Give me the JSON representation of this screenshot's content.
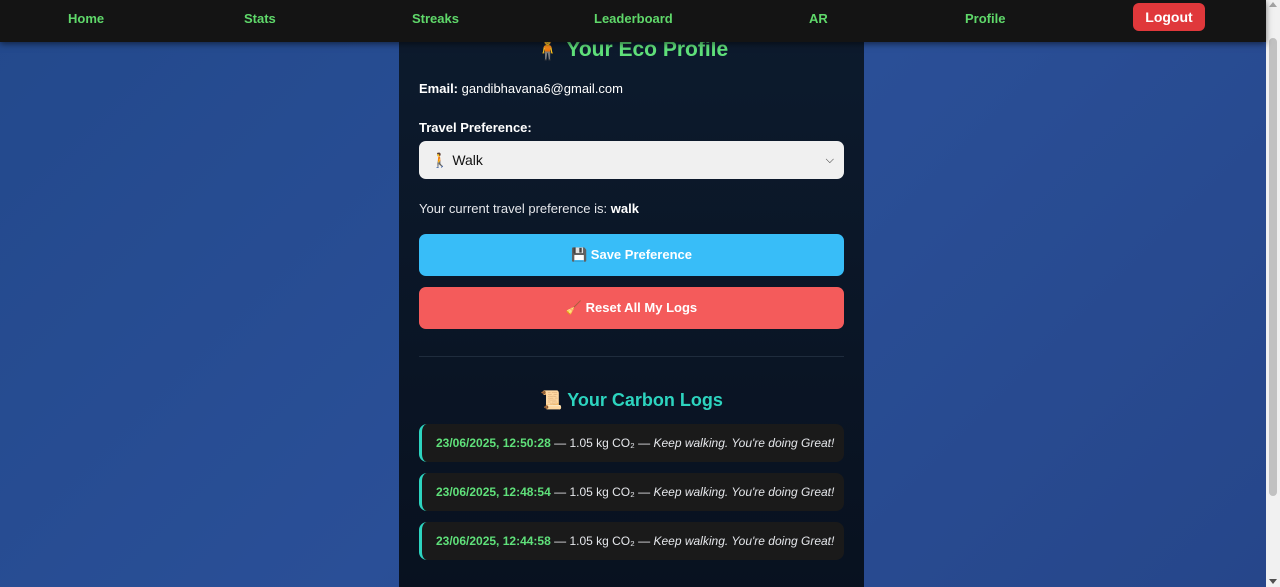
{
  "nav": {
    "home": "Home",
    "stats": "Stats",
    "streaks": "Streaks",
    "leaderboard": "Leaderboard",
    "ar": "AR",
    "profile": "Profile",
    "logout": "Logout"
  },
  "profile": {
    "title": "🧍 Your Eco Profile",
    "email_label": "Email:",
    "email_value": "gandibhavana6@gmail.com",
    "travel_label": "Travel Preference:",
    "selected_option": "🚶 Walk",
    "current_pref_text": "Your current travel preference is:",
    "current_pref_value": "walk",
    "save_button": "💾 Save Preference",
    "reset_button": "🧹 Reset All My Logs"
  },
  "logs": {
    "title": "📜 Your Carbon Logs",
    "entries": [
      {
        "date": "23/06/2025, 12:50:28",
        "amount": "— 1.05 kg CO₂ —",
        "message": "Keep walking. You're doing Great!"
      },
      {
        "date": "23/06/2025, 12:48:54",
        "amount": "— 1.05 kg CO₂ —",
        "message": "Keep walking. You're doing Great!"
      },
      {
        "date": "23/06/2025, 12:44:58",
        "amount": "— 1.05 kg CO₂ —",
        "message": "Keep walking. You're doing Great!"
      }
    ]
  },
  "colors": {
    "nav_link": "#5fd86a",
    "logout_bg": "#e0383b",
    "save_bg": "#38bdf8",
    "reset_bg": "#f45b5b",
    "logs_accent": "#2dd4bf"
  }
}
